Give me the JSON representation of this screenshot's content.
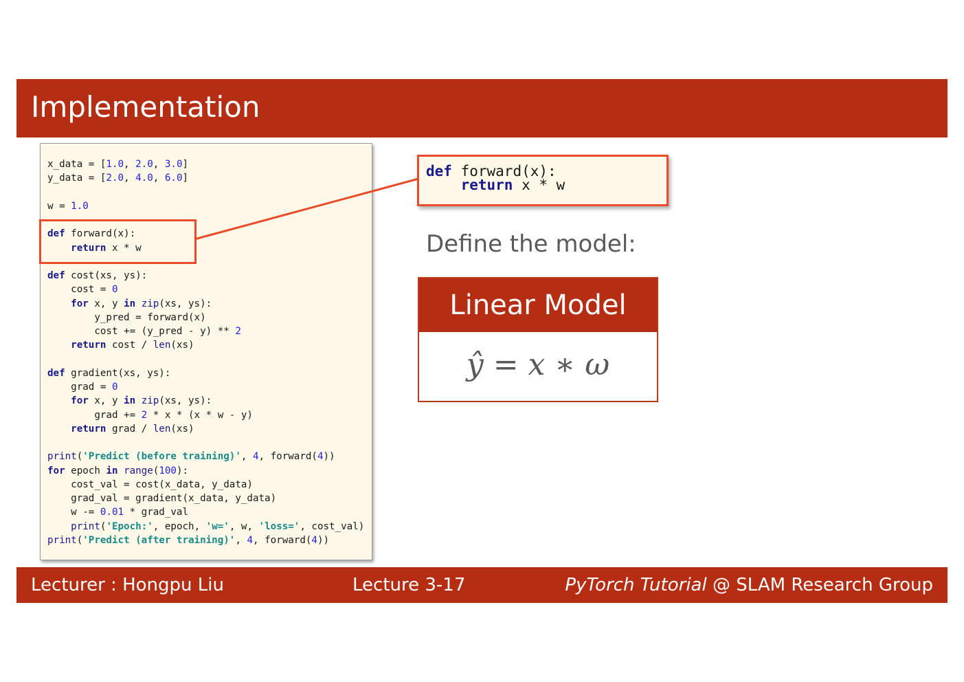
{
  "slide": {
    "title": "Implementation"
  },
  "code": {
    "lines": [
      [
        {
          "t": "x_data = [",
          "c": "plain"
        },
        {
          "t": "1.0",
          "c": "num"
        },
        {
          "t": ", ",
          "c": "plain"
        },
        {
          "t": "2.0",
          "c": "num"
        },
        {
          "t": ", ",
          "c": "plain"
        },
        {
          "t": "3.0",
          "c": "num"
        },
        {
          "t": "]",
          "c": "plain"
        }
      ],
      [
        {
          "t": "y_data = [",
          "c": "plain"
        },
        {
          "t": "2.0",
          "c": "num"
        },
        {
          "t": ", ",
          "c": "plain"
        },
        {
          "t": "4.0",
          "c": "num"
        },
        {
          "t": ", ",
          "c": "plain"
        },
        {
          "t": "6.0",
          "c": "num"
        },
        {
          "t": "]",
          "c": "plain"
        }
      ],
      [],
      [
        {
          "t": "w = ",
          "c": "plain"
        },
        {
          "t": "1.0",
          "c": "num"
        }
      ],
      [],
      [
        {
          "t": "def",
          "c": "kw"
        },
        {
          "t": " forward(x):",
          "c": "plain"
        }
      ],
      [
        {
          "t": "    ",
          "c": "plain"
        },
        {
          "t": "return",
          "c": "kw"
        },
        {
          "t": " x * w",
          "c": "plain"
        }
      ],
      [],
      [
        {
          "t": "def",
          "c": "kw"
        },
        {
          "t": " cost(xs, ys):",
          "c": "plain"
        }
      ],
      [
        {
          "t": "    cost = ",
          "c": "plain"
        },
        {
          "t": "0",
          "c": "num"
        }
      ],
      [
        {
          "t": "    ",
          "c": "plain"
        },
        {
          "t": "for",
          "c": "kw"
        },
        {
          "t": " x, y ",
          "c": "plain"
        },
        {
          "t": "in",
          "c": "kw"
        },
        {
          "t": " ",
          "c": "plain"
        },
        {
          "t": "zip",
          "c": "bi"
        },
        {
          "t": "(xs, ys):",
          "c": "plain"
        }
      ],
      [
        {
          "t": "        y_pred = forward(x)",
          "c": "plain"
        }
      ],
      [
        {
          "t": "        cost += (y_pred - y) ** ",
          "c": "plain"
        },
        {
          "t": "2",
          "c": "num"
        }
      ],
      [
        {
          "t": "    ",
          "c": "plain"
        },
        {
          "t": "return",
          "c": "kw"
        },
        {
          "t": " cost / ",
          "c": "plain"
        },
        {
          "t": "len",
          "c": "bi"
        },
        {
          "t": "(xs)",
          "c": "plain"
        }
      ],
      [],
      [
        {
          "t": "def",
          "c": "kw"
        },
        {
          "t": " gradient(xs, ys):",
          "c": "plain"
        }
      ],
      [
        {
          "t": "    grad = ",
          "c": "plain"
        },
        {
          "t": "0",
          "c": "num"
        }
      ],
      [
        {
          "t": "    ",
          "c": "plain"
        },
        {
          "t": "for",
          "c": "kw"
        },
        {
          "t": " x, y ",
          "c": "plain"
        },
        {
          "t": "in",
          "c": "kw"
        },
        {
          "t": " ",
          "c": "plain"
        },
        {
          "t": "zip",
          "c": "bi"
        },
        {
          "t": "(xs, ys):",
          "c": "plain"
        }
      ],
      [
        {
          "t": "        grad += ",
          "c": "plain"
        },
        {
          "t": "2",
          "c": "num"
        },
        {
          "t": " * x * (x * w - y)",
          "c": "plain"
        }
      ],
      [
        {
          "t": "    ",
          "c": "plain"
        },
        {
          "t": "return",
          "c": "kw"
        },
        {
          "t": " grad / ",
          "c": "plain"
        },
        {
          "t": "len",
          "c": "bi"
        },
        {
          "t": "(xs)",
          "c": "plain"
        }
      ],
      [],
      [
        {
          "t": "print",
          "c": "bi"
        },
        {
          "t": "(",
          "c": "plain"
        },
        {
          "t": "'Predict (before training)'",
          "c": "str"
        },
        {
          "t": ", ",
          "c": "plain"
        },
        {
          "t": "4",
          "c": "num"
        },
        {
          "t": ", forward(",
          "c": "plain"
        },
        {
          "t": "4",
          "c": "num"
        },
        {
          "t": "))",
          "c": "plain"
        }
      ],
      [
        {
          "t": "for",
          "c": "kw"
        },
        {
          "t": " epoch ",
          "c": "plain"
        },
        {
          "t": "in",
          "c": "kw"
        },
        {
          "t": " ",
          "c": "plain"
        },
        {
          "t": "range",
          "c": "bi"
        },
        {
          "t": "(",
          "c": "plain"
        },
        {
          "t": "100",
          "c": "num"
        },
        {
          "t": "):",
          "c": "plain"
        }
      ],
      [
        {
          "t": "    cost_val = cost(x_data, y_data)",
          "c": "plain"
        }
      ],
      [
        {
          "t": "    grad_val = gradient(x_data, y_data)",
          "c": "plain"
        }
      ],
      [
        {
          "t": "    w -= ",
          "c": "plain"
        },
        {
          "t": "0.01",
          "c": "num"
        },
        {
          "t": " * grad_val",
          "c": "plain"
        }
      ],
      [
        {
          "t": "    ",
          "c": "plain"
        },
        {
          "t": "print",
          "c": "bi"
        },
        {
          "t": "(",
          "c": "plain"
        },
        {
          "t": "'Epoch:'",
          "c": "str"
        },
        {
          "t": ", epoch, ",
          "c": "plain"
        },
        {
          "t": "'w='",
          "c": "str"
        },
        {
          "t": ", w, ",
          "c": "plain"
        },
        {
          "t": "'loss='",
          "c": "str"
        },
        {
          "t": ", cost_val)",
          "c": "plain"
        }
      ],
      [
        {
          "t": "print",
          "c": "bi"
        },
        {
          "t": "(",
          "c": "plain"
        },
        {
          "t": "'Predict (after training)'",
          "c": "str"
        },
        {
          "t": ", ",
          "c": "plain"
        },
        {
          "t": "4",
          "c": "num"
        },
        {
          "t": ", forward(",
          "c": "plain"
        },
        {
          "t": "4",
          "c": "num"
        },
        {
          "t": "))",
          "c": "plain"
        }
      ]
    ]
  },
  "zoom": {
    "lines": [
      [
        {
          "t": "def",
          "c": "kw"
        },
        {
          "t": " forward(x):",
          "c": "plain"
        }
      ],
      [
        {
          "t": "    ",
          "c": "plain"
        },
        {
          "t": "return",
          "c": "kw"
        },
        {
          "t": " x * w",
          "c": "plain"
        }
      ]
    ]
  },
  "define_label": "Define the model:",
  "model_card": {
    "title": "Linear Model",
    "formula": "ŷ = x ∗ ω"
  },
  "footer": {
    "lecturer": "Lecturer : Hongpu Liu",
    "lecture": "Lecture 3-17",
    "course_italic": "PyTorch Tutorial",
    "course_rest": " @ SLAM Research Group"
  },
  "colors": {
    "brand_red": "#b52d12",
    "highlight_orange": "#ea4b2a",
    "code_bg": "#fdf8e7",
    "keyword": "#1a1a8c",
    "number": "#2222dd",
    "string": "#1a8a8a"
  }
}
